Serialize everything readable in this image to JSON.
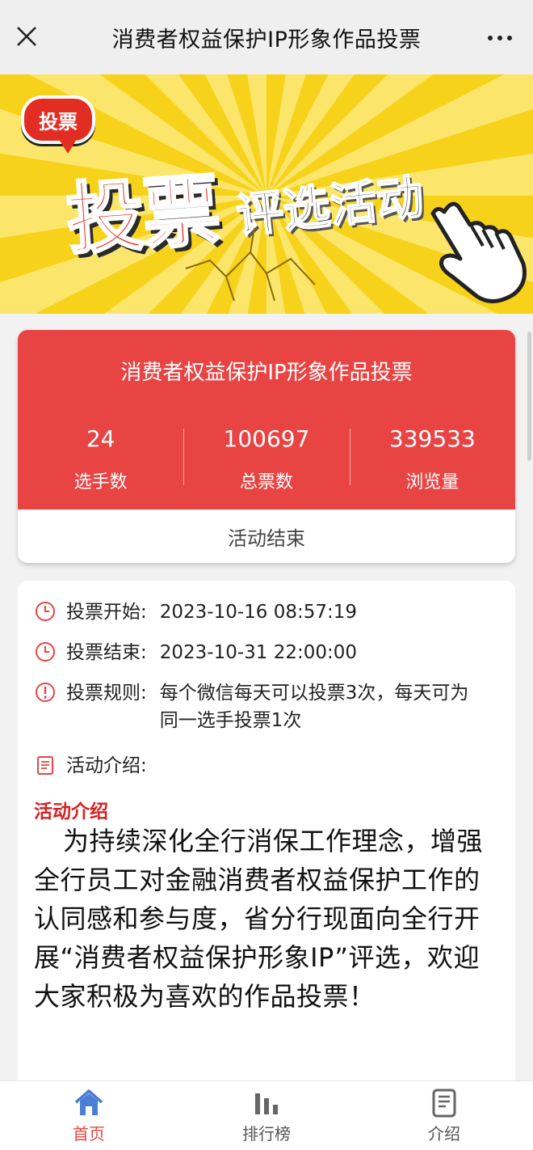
{
  "nav": {
    "title": "消费者权益保护IP形象作品投票"
  },
  "banner": {
    "tag": "投票",
    "big_text": "投票",
    "sub_text": "评选活动"
  },
  "stats": {
    "activity_name": "消费者权益保护IP形象作品投票",
    "items": [
      {
        "value": "24",
        "label": "选手数"
      },
      {
        "value": "100697",
        "label": "总票数"
      },
      {
        "value": "339533",
        "label": "浏览量"
      }
    ],
    "status": "活动结束"
  },
  "info": {
    "start": {
      "label": "投票开始:",
      "value": "2023-10-16 08:57:19"
    },
    "end": {
      "label": "投票结束:",
      "value": "2023-10-31 22:00:00"
    },
    "rule": {
      "label": "投票规则:",
      "value": "每个微信每天可以投票3次，每天可为同一选手投票1次"
    },
    "intro_label": "活动介绍:",
    "intro_title": "活动介绍",
    "intro_body": "为持续深化全行消保工作理念，增强全行员工对金融消费者权益保护工作的认同感和参与度，省分行现面向全行开展“消费者权益保护形象IP”评选，欢迎大家积极为喜欢的作品投票！"
  },
  "tabs": [
    {
      "label": "首页",
      "icon": "home-icon",
      "active": true
    },
    {
      "label": "排行榜",
      "icon": "bar-chart-icon",
      "active": false
    },
    {
      "label": "介绍",
      "icon": "document-icon",
      "active": false
    }
  ],
  "colors": {
    "accent": "#e94444",
    "banner_yellow": "#f7d21a",
    "intro_title": "#d62222",
    "home_icon": "#4a7fd6"
  }
}
